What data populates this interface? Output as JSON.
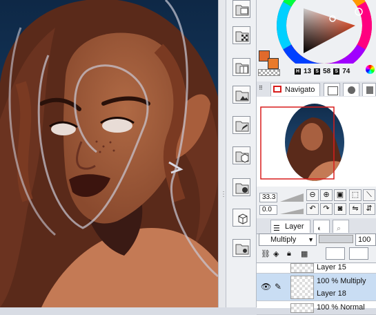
{
  "colors": {
    "main_color": "#e06a2c",
    "sub_color": "#e87a2a",
    "accent": "#d81c1c"
  },
  "hsv": {
    "h_label": "H",
    "h": "13",
    "s_label": "S",
    "s": "58",
    "v_label": "S",
    "v": "74"
  },
  "navigator": {
    "tab_label": "Navigato",
    "zoom": "33.3",
    "angle": "0.0"
  },
  "layer_panel": {
    "tab_label": "Layer",
    "blend_mode": "Multiply",
    "opacity": "100"
  },
  "layers": [
    {
      "name": "Layer 15",
      "info": ""
    },
    {
      "name": "Layer 18",
      "info": "100 % Multiply"
    },
    {
      "name": "",
      "info": "100 % Normal"
    }
  ],
  "icons": [
    "eye-icon",
    "pen-icon",
    "link-icon",
    "new-layer-icon",
    "layer-folder-icon",
    "zoom-in-icon",
    "zoom-out-icon",
    "rotate-icon",
    "flip-icon"
  ]
}
